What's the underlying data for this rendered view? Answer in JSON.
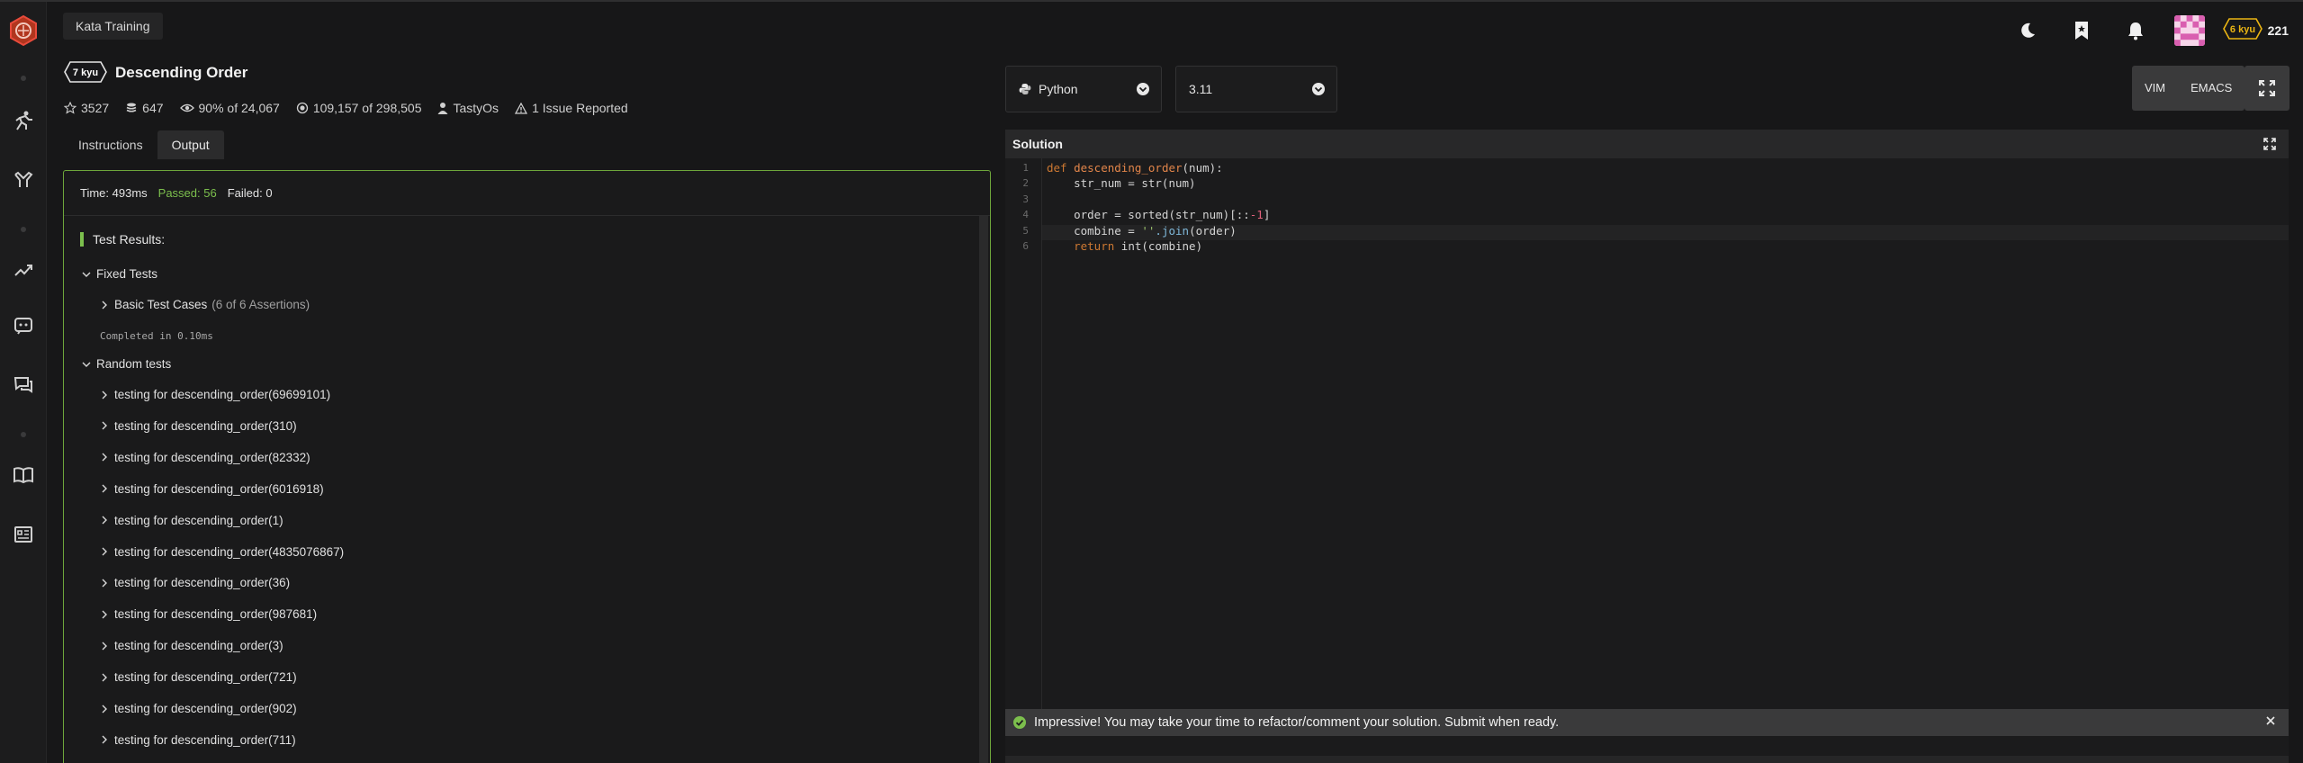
{
  "breadcrumb": "Kata Training",
  "user": {
    "rank": "6 kyu",
    "honor": "221"
  },
  "kata": {
    "rank": "7 kyu",
    "title": "Descending Order",
    "stats": {
      "stars": "3527",
      "collections": "647",
      "satisfaction": "90% of 24,067",
      "completions": "109,157 of 298,505",
      "author": "TastyOs",
      "issues": "1 Issue Reported"
    }
  },
  "tabs": [
    "Instructions",
    "Output"
  ],
  "output": {
    "time": "Time: 493ms",
    "passed": "Passed: 56",
    "failed": "Failed: 0",
    "results_title": "Test Results:",
    "fixed_group": "Fixed Tests",
    "basic_cases": "Basic Test Cases",
    "basic_assertions": "(6 of 6 Assertions)",
    "completed": "Completed in 0.10ms",
    "random_group": "Random tests",
    "random_tests": [
      "testing for descending_order(69699101)",
      "testing for descending_order(310)",
      "testing for descending_order(82332)",
      "testing for descending_order(6016918)",
      "testing for descending_order(1)",
      "testing for descending_order(4835076867)",
      "testing for descending_order(36)",
      "testing for descending_order(987681)",
      "testing for descending_order(3)",
      "testing for descending_order(721)",
      "testing for descending_order(902)",
      "testing for descending_order(711)"
    ]
  },
  "language": "Python",
  "version": "3.11",
  "modes": [
    "VIM",
    "EMACS"
  ],
  "editor": {
    "title": "Solution",
    "line_numbers": [
      "1",
      "2",
      "3",
      "4",
      "5",
      "6"
    ],
    "code": {
      "l1_def": "def",
      "l1_name": "descending_order",
      "l1_rest": "(num):",
      "l2": "    str_num = str(num)",
      "l4_a": "    order = sorted(str_num)[::",
      "l4_num": "-1",
      "l4_b": "]",
      "l5_a": "    combine = ",
      "l5_str": "''",
      "l5_call": ".join",
      "l5_b": "(order)",
      "l6_kw": "return",
      "l6_b": " int(combine)"
    }
  },
  "toast": "Impressive! You may take your time to refactor/comment your solution. Submit when ready.",
  "colors": {
    "accent": "#e84a3b",
    "passed": "#7cbf4d",
    "rank_badge": "#ecb613"
  }
}
